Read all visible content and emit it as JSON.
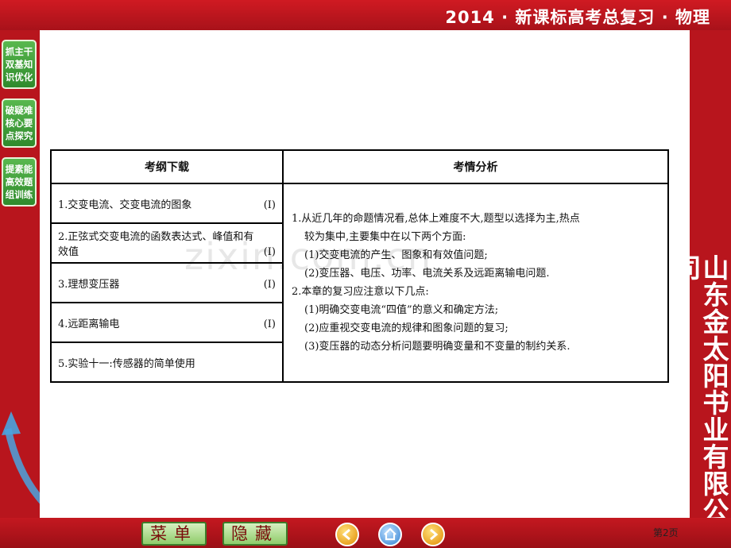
{
  "header": {
    "title": "2014 · 新课标高考总复习 · 物理"
  },
  "sidebar": {
    "items": [
      {
        "label": "抓主干双基知识优化"
      },
      {
        "label": "破疑难核心要点探究"
      },
      {
        "label": "提素能高效题组训练"
      }
    ]
  },
  "publisher": "山东金太阳书业有限公司",
  "watermark": "zixin.com.cn",
  "table": {
    "headers": [
      "考纲下载",
      "考情分析"
    ],
    "outline": [
      {
        "text": "1.交变电流、交变电流的图象",
        "level": "(Ⅰ)"
      },
      {
        "text": "2.正弦式交变电流的函数表达式、峰值和有效值",
        "level": "(Ⅰ)"
      },
      {
        "text": "3.理想变压器",
        "level": "(Ⅰ)"
      },
      {
        "text": "4.远距离输电",
        "level": "(Ⅰ)"
      },
      {
        "text": "5.实验十一:传感器的简单使用",
        "level": ""
      }
    ],
    "analysis": [
      {
        "text": "1.从近几年的命题情况看,总体上难度不大,题型以选择为主,热点",
        "indent": false
      },
      {
        "text": "较为集中,主要集中在以下两个方面:",
        "indent": true
      },
      {
        "text": "(1)交变电流的产生、图象和有效值问题;",
        "indent": true
      },
      {
        "text": "(2)变压器、电压、功率、电流关系及远距离输电问题.",
        "indent": true
      },
      {
        "text": "2.本章的复习应注意以下几点:",
        "indent": false
      },
      {
        "text": "(1)明确交变电流“四值”的意义和确定方法;",
        "indent": true
      },
      {
        "text": "(2)应重视交变电流的规律和图象问题的复习;",
        "indent": true
      },
      {
        "text": "(3)变压器的动态分析问题要明确变量和不变量的制约关系.",
        "indent": true
      }
    ]
  },
  "footer": {
    "menu_label": "菜单",
    "hide_label": "隐藏",
    "page_label": "第2页"
  }
}
